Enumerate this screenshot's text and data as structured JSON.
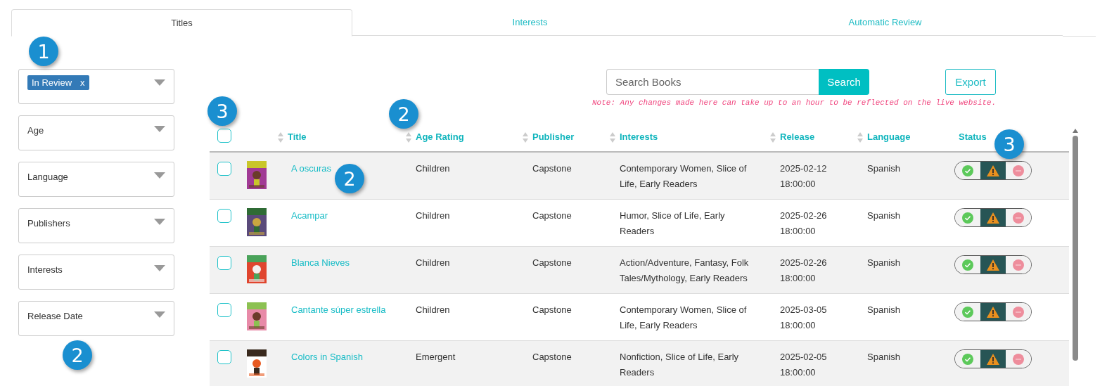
{
  "tabs": [
    {
      "label": "Titles",
      "selected": true
    },
    {
      "label": "Interests",
      "selected": false
    },
    {
      "label": "Automatic Review",
      "selected": false
    }
  ],
  "filters": [
    {
      "kind": "tags",
      "tags": [
        {
          "label": "In Review",
          "remove": "x"
        }
      ]
    },
    {
      "kind": "empty",
      "placeholder": "Age"
    },
    {
      "kind": "empty",
      "placeholder": "Language"
    },
    {
      "kind": "empty",
      "placeholder": "Publishers"
    },
    {
      "kind": "empty",
      "placeholder": "Interests"
    },
    {
      "kind": "empty",
      "placeholder": "Release Date"
    }
  ],
  "search": {
    "placeholder": "Search Books",
    "button": "Search"
  },
  "export_button": "Export",
  "note": "Note: Any changes made here can take up to an hour to be reflected on the live website.",
  "table": {
    "select_all_checked": false,
    "columns": [
      {
        "label": "Title",
        "sortable": true
      },
      {
        "label": "Age Rating",
        "sortable": true
      },
      {
        "label": "Publisher",
        "sortable": true
      },
      {
        "label": "Interests",
        "sortable": true
      },
      {
        "label": "Release",
        "sortable": true
      },
      {
        "label": "Language",
        "sortable": true
      },
      {
        "label": "Status",
        "sortable": false
      }
    ],
    "rows": [
      {
        "checked": false,
        "title": "A oscuras",
        "age_rating": "Children",
        "publisher": "Capstone",
        "interests": "Contemporary Women, Slice of Life, Early Readers",
        "release": "2025-02-12 18:00:00",
        "language": "Spanish",
        "status": [
          {
            "kind": "approve",
            "selected": false
          },
          {
            "kind": "review",
            "selected": true
          },
          {
            "kind": "reject",
            "selected": false
          }
        ]
      },
      {
        "checked": false,
        "title": "Acampar",
        "age_rating": "Children",
        "publisher": "Capstone",
        "interests": "Humor, Slice of Life, Early Readers",
        "release": "2025-02-26 18:00:00",
        "language": "Spanish",
        "status": [
          {
            "kind": "approve",
            "selected": false
          },
          {
            "kind": "review",
            "selected": true
          },
          {
            "kind": "reject",
            "selected": false
          }
        ]
      },
      {
        "checked": false,
        "title": "Blanca Nieves",
        "age_rating": "Children",
        "publisher": "Capstone",
        "interests": "Action/Adventure, Fantasy, Folk Tales/Mythology, Early Readers",
        "release": "2025-02-26 18:00:00",
        "language": "Spanish",
        "status": [
          {
            "kind": "approve",
            "selected": false
          },
          {
            "kind": "review",
            "selected": true
          },
          {
            "kind": "reject",
            "selected": false
          }
        ]
      },
      {
        "checked": false,
        "title": "Cantante súper estrella",
        "age_rating": "Children",
        "publisher": "Capstone",
        "interests": "Contemporary Women, Slice of Life, Early Readers",
        "release": "2025-03-05 18:00:00",
        "language": "Spanish",
        "status": [
          {
            "kind": "approve",
            "selected": false
          },
          {
            "kind": "review",
            "selected": true
          },
          {
            "kind": "reject",
            "selected": false
          }
        ]
      },
      {
        "checked": false,
        "title": "Colors in Spanish",
        "age_rating": "Emergent",
        "publisher": "Capstone",
        "interests": "Nonfiction, Slice of Life, Early Readers",
        "release": "2025-02-05 18:00:00",
        "language": "Spanish",
        "status": [
          {
            "kind": "approve",
            "selected": false
          },
          {
            "kind": "review",
            "selected": true
          },
          {
            "kind": "reject",
            "selected": false
          }
        ]
      }
    ]
  },
  "callouts": [
    {
      "label": "1"
    },
    {
      "label": "2"
    },
    {
      "label": "3"
    },
    {
      "label": "2"
    },
    {
      "label": "2"
    },
    {
      "label": "3"
    }
  ]
}
